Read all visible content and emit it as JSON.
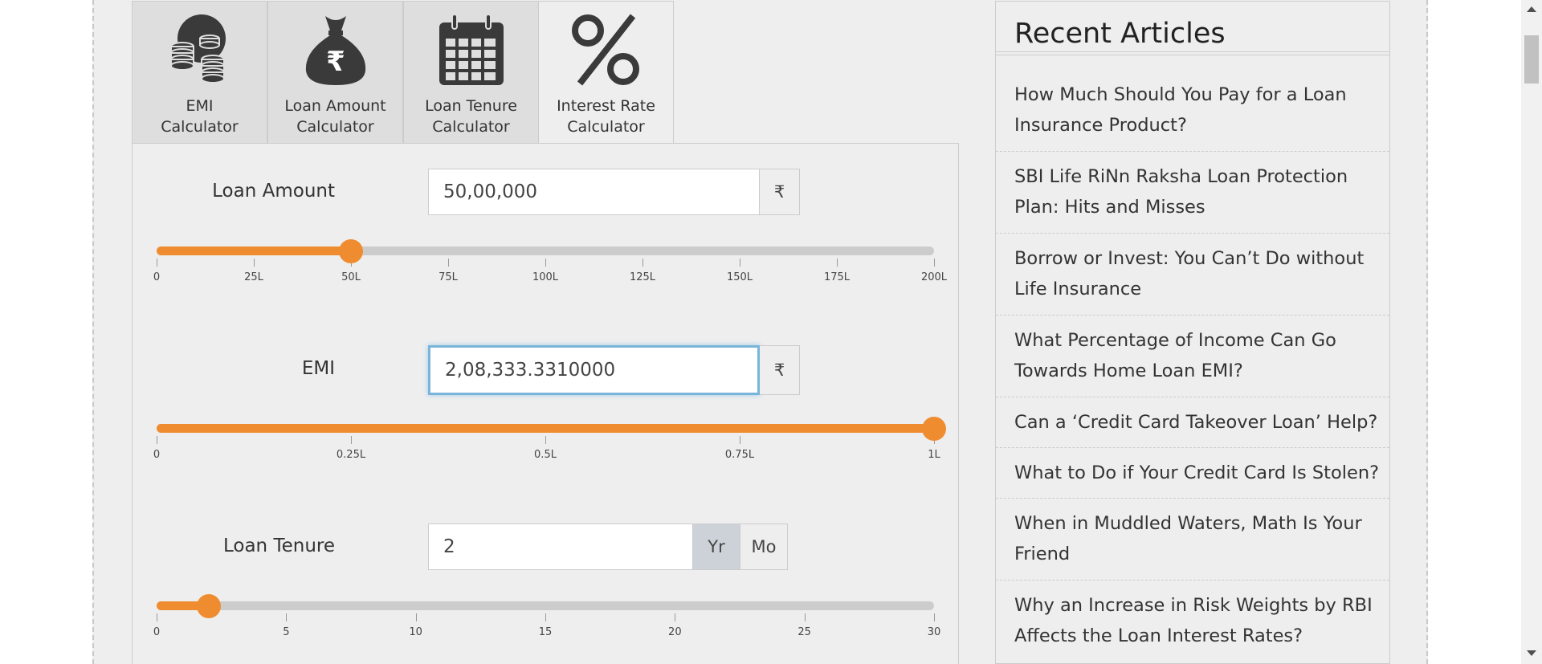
{
  "tabs": [
    {
      "line1": "EMI",
      "line2": "Calculator",
      "icon": "coins-icon"
    },
    {
      "line1": "Loan Amount",
      "line2": "Calculator",
      "icon": "money-bag-icon"
    },
    {
      "line1": "Loan Tenure",
      "line2": "Calculator",
      "icon": "calendar-icon"
    },
    {
      "line1": "Interest Rate",
      "line2": "Calculator",
      "icon": "percent-icon"
    }
  ],
  "loan_amount": {
    "label": "Loan Amount",
    "value": "50,00,000",
    "currency": "₹",
    "slider_value": 0.25,
    "ticks": [
      "0",
      "25L",
      "50L",
      "75L",
      "100L",
      "125L",
      "150L",
      "175L",
      "200L"
    ]
  },
  "emi": {
    "label": "EMI",
    "value": "2,08,333.3310000",
    "currency": "₹",
    "slider_value": 1.0,
    "ticks": [
      "0",
      "0.25L",
      "0.5L",
      "0.75L",
      "1L"
    ]
  },
  "loan_tenure": {
    "label": "Loan Tenure",
    "value": "2",
    "unit_year": "Yr",
    "unit_month": "Mo",
    "slider_value": 0.0667,
    "ticks": [
      "0",
      "5",
      "10",
      "15",
      "20",
      "25",
      "30"
    ]
  },
  "sidebar": {
    "title": "Recent Articles",
    "articles": [
      {
        "line1": "How Much Should You Pay for a Loan",
        "line2": "Insurance Product?"
      },
      {
        "line1": "SBI Life RiNn Raksha Loan Protection",
        "line2": "Plan: Hits and Misses"
      },
      {
        "line1": "Borrow or Invest: You Can’t Do without",
        "line2": "Life Insurance"
      },
      {
        "line1": "What Percentage of Income Can Go",
        "line2": "Towards Home Loan EMI?"
      },
      {
        "line1": "Can a ‘Credit Card Takeover Loan’ Help?",
        "line2": ""
      },
      {
        "line1": "What to Do if Your Credit Card Is Stolen?",
        "line2": ""
      },
      {
        "line1": "When in Muddled Waters, Math Is Your",
        "line2": "Friend"
      },
      {
        "line1": "Why an Increase in Risk Weights by RBI",
        "line2": "Affects the Loan Interest Rates?"
      }
    ]
  },
  "colors": {
    "accent": "#ef8c30",
    "track": "#cccccc",
    "focus": "#79b5d8"
  }
}
